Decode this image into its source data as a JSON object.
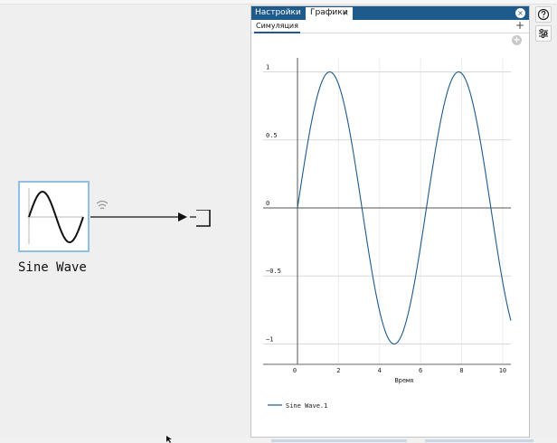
{
  "canvas": {
    "block": {
      "label": "Sine Wave",
      "icon": "sine-wave-icon"
    },
    "signal_icon": "wifi-signal-icon",
    "output_icon": "output-port-icon"
  },
  "panel": {
    "tabs": [
      {
        "label": "Настройки",
        "active": false
      },
      {
        "label": "Графики",
        "active": true,
        "close_glyph": "×"
      }
    ],
    "close_glyph": "×",
    "subtabs": [
      {
        "label": "Симуляция"
      }
    ],
    "add_subtab_glyph": "+",
    "add_plot_glyph": "+"
  },
  "toolbar": {
    "help_icon": "help-circle-icon",
    "settings_icon": "sliders-icon"
  },
  "chart_data": {
    "type": "line",
    "title": "",
    "xlabel": "Время",
    "ylabel": "",
    "xlim": [
      0,
      10.4
    ],
    "ylim": [
      -1.05,
      1.05
    ],
    "x_ticks": [
      0,
      2,
      4,
      6,
      8,
      10
    ],
    "y_ticks": [
      1,
      0.5,
      0,
      -0.5,
      -1
    ],
    "y_tick_labels": [
      "1",
      "0.5",
      "0",
      "−0.5",
      "−1"
    ],
    "grid": true,
    "legend_position": "bottom-left",
    "series": [
      {
        "name": "Sine Wave.1",
        "color": "#1f5a8c",
        "function": "sin(t)",
        "x": [
          0,
          0.8,
          1.57,
          2.4,
          3.14,
          3.9,
          4.71,
          5.5,
          6.28,
          7.1,
          7.85,
          8.6,
          9.42,
          10.2
        ],
        "y": [
          0,
          0.72,
          1,
          0.68,
          0,
          -0.69,
          -1,
          -0.71,
          0,
          0.73,
          1,
          0.73,
          0,
          -0.7
        ]
      }
    ]
  }
}
